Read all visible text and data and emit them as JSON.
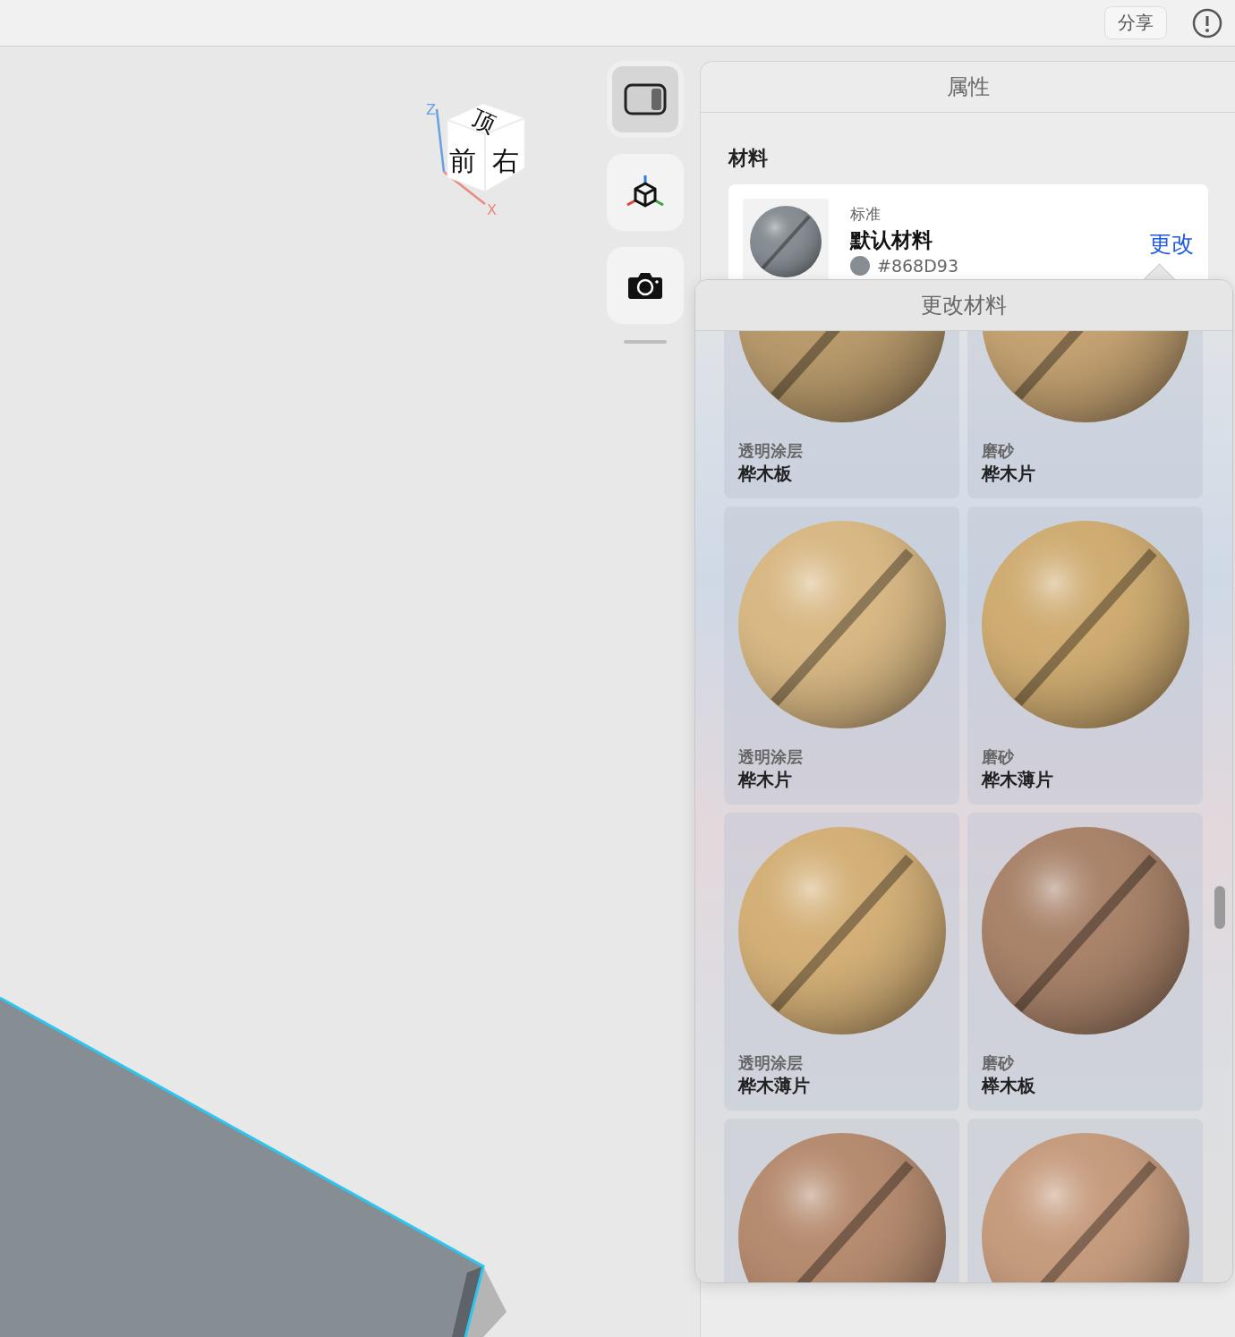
{
  "toolbar": {
    "share_button": "分享"
  },
  "view_cube": {
    "top": "顶",
    "front": "前",
    "right": "右",
    "z_axis": "Z",
    "x_axis": "X"
  },
  "tools": [
    {
      "kind": "panel",
      "selected": true
    },
    {
      "kind": "axes",
      "selected": false
    },
    {
      "kind": "camera",
      "selected": false
    }
  ],
  "properties_panel": {
    "title": "属性",
    "section": "材料",
    "material": {
      "type": "标准",
      "name": "默认材料",
      "color": "#868d93",
      "hex": "#868D93",
      "change_link": "更改"
    }
  },
  "change_material_popover": {
    "title": "更改材料",
    "materials": [
      {
        "category": "透明涂层",
        "name": "桦木板",
        "color": "#b89a6c"
      },
      {
        "category": "磨砂",
        "name": "桦木片",
        "color": "#c4a272"
      },
      {
        "category": "透明涂层",
        "name": "桦木片",
        "color": "#d8b884"
      },
      {
        "category": "磨砂",
        "name": "桦木薄片",
        "color": "#cfac72"
      },
      {
        "category": "透明涂层",
        "name": "桦木薄片",
        "color": "#d4b078"
      },
      {
        "category": "磨砂",
        "name": "榉木板",
        "color": "#a9836a"
      },
      {
        "color": "#b68c70"
      },
      {
        "color": "#c69c7e"
      }
    ]
  }
}
